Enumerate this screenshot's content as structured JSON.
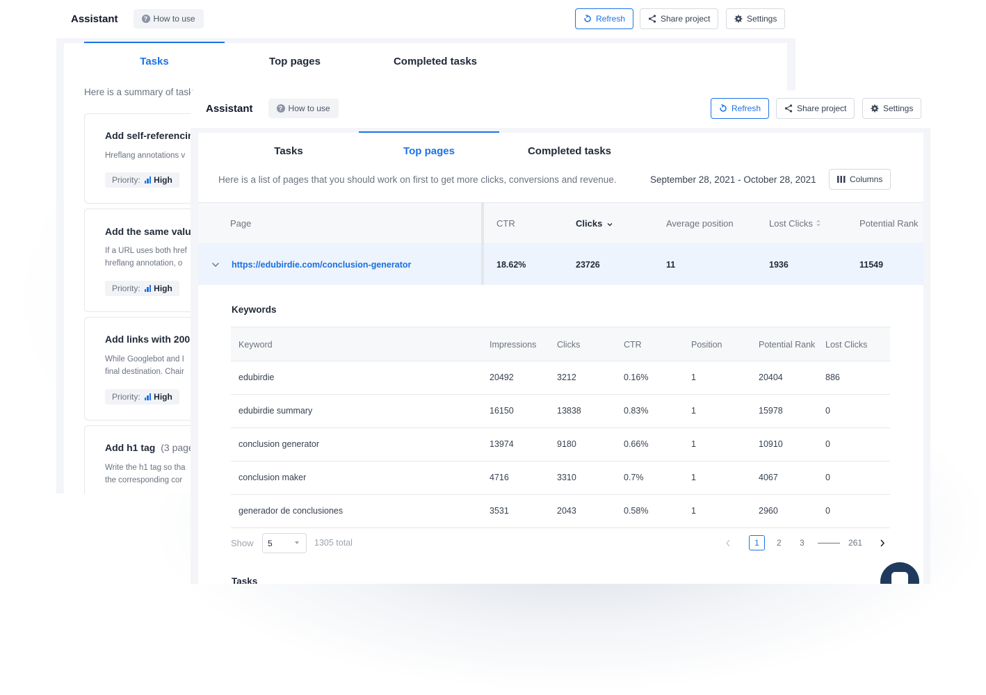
{
  "colors": {
    "accent": "#1a73e8",
    "link": "#1a6fe0",
    "text": "#1f2937",
    "muted": "#6b7280"
  },
  "back_window": {
    "header": {
      "title": "Assistant",
      "how_to_use": "How to use",
      "refresh": "Refresh",
      "share": "Share project",
      "settings": "Settings"
    },
    "tabs": [
      "Tasks",
      "Top pages",
      "Completed tasks"
    ],
    "active_tab": "Tasks",
    "summary": "Here is a summary of task",
    "tasks": [
      {
        "title": "Add self-referencin",
        "desc": [
          "Hreflang annotations v"
        ],
        "priority_label": "Priority:",
        "priority": "High"
      },
      {
        "title": "Add the same valu",
        "desc": [
          "If a URL uses both href",
          "hreflang annotation, o"
        ],
        "priority_label": "Priority:",
        "priority": "High"
      },
      {
        "title": "Add links with 200",
        "desc": [
          "While Googlebot and I",
          "final destination. Chair"
        ],
        "priority_label": "Priority:",
        "priority": "High"
      },
      {
        "title": "Add h1 tag",
        "count": "(3 page",
        "desc": [
          "Write the h1 tag so tha",
          "the corresponding cor"
        ]
      }
    ]
  },
  "front_window": {
    "header": {
      "title": "Assistant",
      "how_to_use": "How to use",
      "refresh": "Refresh",
      "share": "Share project",
      "settings": "Settings"
    },
    "tabs": [
      "Tasks",
      "Top pages",
      "Completed tasks"
    ],
    "active_tab": "Top pages",
    "description": "Here is a list of pages that you should work on first to get more clicks, conversions and revenue.",
    "date_range": "September 28, 2021 - October 28, 2021",
    "columns_button": "Columns",
    "pages_table": {
      "headers": [
        "Page",
        "CTR",
        "Clicks",
        "Average position",
        "Lost Clicks",
        "Potential Rank"
      ],
      "row": {
        "url": "https://edubirdie.com/conclusion-generator",
        "ctr": "18.62%",
        "clicks": "23726",
        "avg_position": "11",
        "lost_clicks": "1936",
        "potential_rank": "11549"
      }
    },
    "keywords": {
      "title": "Keywords",
      "headers": [
        "Keyword",
        "Impressions",
        "Clicks",
        "CTR",
        "Position",
        "Potential Rank",
        "Lost Clicks"
      ],
      "rows": [
        [
          "edubirdie",
          "20492",
          "3212",
          "0.16%",
          "1",
          "20404",
          "886"
        ],
        [
          "edubirdie summary",
          "16150",
          "13838",
          "0.83%",
          "1",
          "15978",
          "0"
        ],
        [
          "conclusion generator",
          "13974",
          "9180",
          "0.66%",
          "1",
          "10910",
          "0"
        ],
        [
          "conclusion maker",
          "4716",
          "3310",
          "0.7%",
          "1",
          "4067",
          "0"
        ],
        [
          "generador de conclusiones",
          "3531",
          "2043",
          "0.58%",
          "1",
          "2960",
          "0"
        ]
      ]
    },
    "pagination": {
      "show_label": "Show",
      "page_size": "5",
      "total": "1305 total",
      "pages": [
        "1",
        "2",
        "3",
        "261"
      ],
      "current": "1"
    },
    "tasks_heading": "Tasks"
  }
}
